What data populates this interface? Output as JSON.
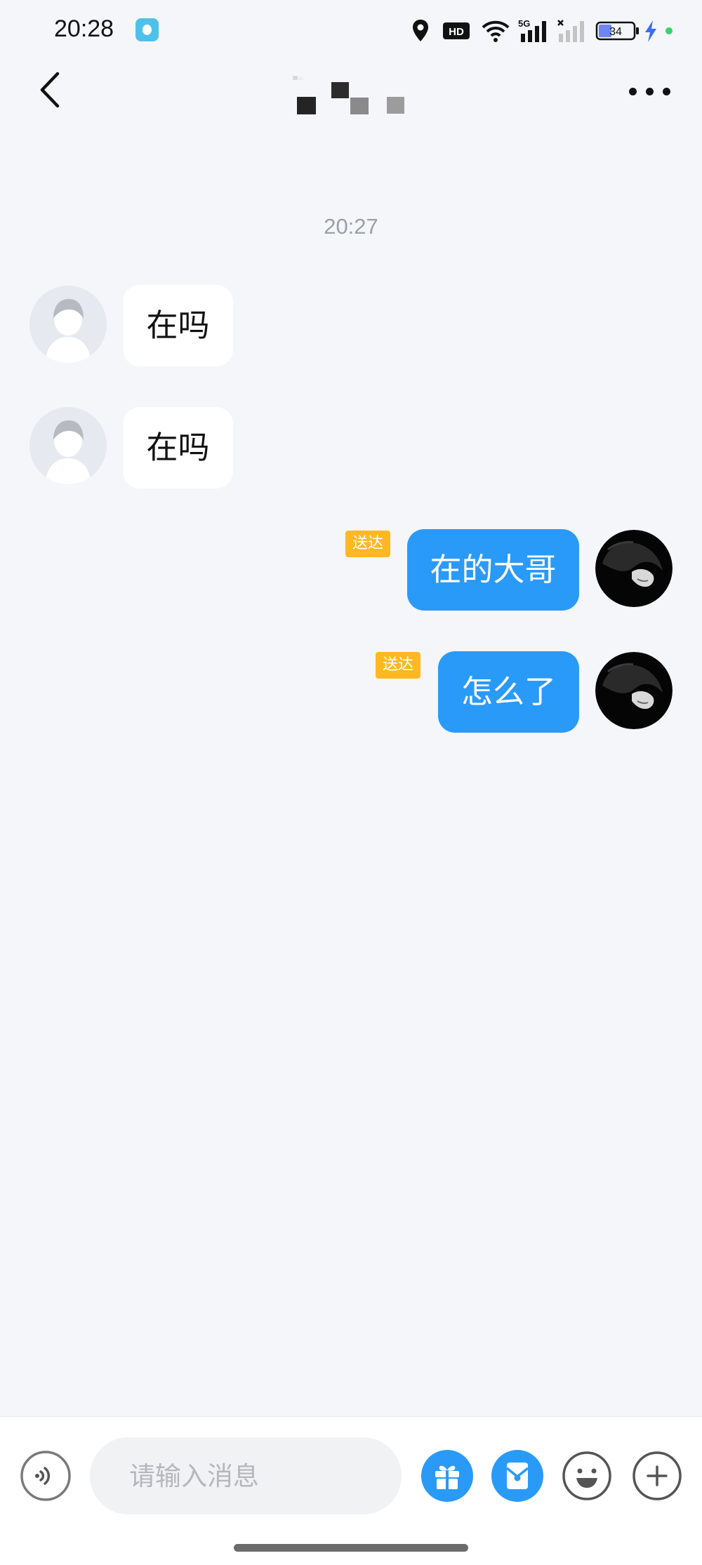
{
  "status_bar": {
    "time": "20:28",
    "icons": [
      "app-badge-icon",
      "location-icon",
      "hd-icon",
      "wifi-icon",
      "signal-5g-icon",
      "signal-no-sim-icon",
      "battery-icon",
      "charging-icon",
      "dot-icon"
    ],
    "network": "5G",
    "hd_label": "HD",
    "battery": "34"
  },
  "header": {
    "back_icon": "chevron-left-icon",
    "title_icon": "pixelated-avatar-icon",
    "more_icon": "more-dots-icon"
  },
  "chat": {
    "timestamp": "20:27",
    "messages": [
      {
        "side": "in",
        "text": "在吗"
      },
      {
        "side": "in",
        "text": "在吗"
      },
      {
        "side": "out",
        "text": "在的大哥",
        "status": "送达"
      },
      {
        "side": "out",
        "text": "怎么了",
        "status": "送达"
      }
    ]
  },
  "composer": {
    "placeholder": "请输入消息",
    "voice_icon": "voice-icon",
    "gift_icon": "gift-icon",
    "red_packet_icon": "red-packet-icon",
    "emoji_icon": "emoji-icon",
    "plus_icon": "plus-icon"
  },
  "colors": {
    "accent": "#2a9af8",
    "delivered_badge": "#ffb822",
    "background": "#f4f6f9"
  }
}
